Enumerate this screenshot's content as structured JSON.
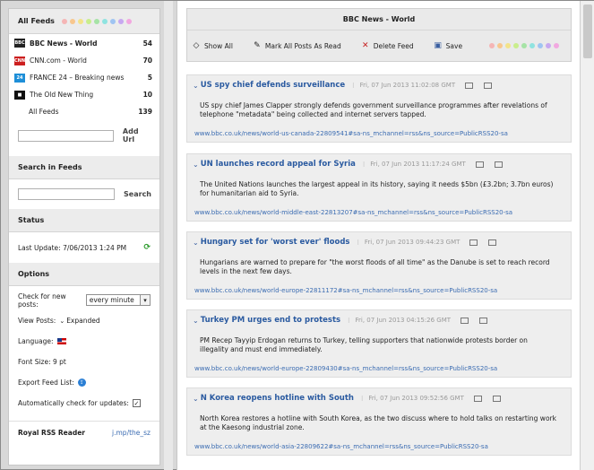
{
  "sidebar": {
    "all_feeds_title": "All Feeds",
    "color_dots": [
      "#f5b5b5",
      "#f8c78e",
      "#f3e38a",
      "#c9ee8c",
      "#a6e3a6",
      "#8fe3e0",
      "#9fc4f2",
      "#c7a8f0",
      "#f2a8e0"
    ],
    "feeds": [
      {
        "name": "BBC News - World",
        "count": "54",
        "fav_color": "#222",
        "fav_text": "BBC"
      },
      {
        "name": "CNN.com - World",
        "count": "70",
        "fav_color": "#cc1f1f",
        "fav_text": "CNN"
      },
      {
        "name": "FRANCE 24 – Breaking news",
        "count": "5",
        "fav_color": "#1e8fd8",
        "fav_text": "24"
      },
      {
        "name": "The Old New Thing",
        "count": "10",
        "fav_color": "#111",
        "fav_text": "■"
      },
      {
        "name": "All Feeds",
        "count": "139"
      }
    ],
    "add_url_label": "Add Url",
    "search_title": "Search in Feeds",
    "search_label": "Search",
    "status_title": "Status",
    "last_update": "Last Update: 7/06/2013 1:24 PM",
    "options_title": "Options",
    "check_label": "Check for new posts:",
    "check_value": "every minute",
    "view_label": "View Posts:",
    "view_value": "Expanded",
    "language_label": "Language:",
    "font_label": "Font Size: 9 pt",
    "export_label": "Export Feed List:",
    "auto_label": "Automatically check for updates:",
    "footer_app": "Royal RSS Reader",
    "footer_link": "j.mp/the_sz"
  },
  "main": {
    "title": "BBC News - World",
    "toolbar": {
      "show_all": "Show All",
      "mark_all": "Mark All Posts As Read",
      "delete_feed": "Delete Feed",
      "save": "Save"
    },
    "posts": [
      {
        "title": "US spy chief defends surveillance",
        "date": "Fri, 07 Jun 2013 11:02:08 GMT",
        "body": "US spy chief James Clapper strongly defends government surveillance programmes after revelations of telephone \"metadata\" being collected and internet servers tapped.",
        "url": "www.bbc.co.uk/news/world-us-canada-22809541#sa-ns_mchannel=rss&ns_source=PublicRSS20-sa"
      },
      {
        "title": "UN launches record appeal for Syria",
        "date": "Fri, 07 Jun 2013 11:17:24 GMT",
        "body": "The United Nations launches the largest appeal in its history, saying it needs $5bn (£3.2bn; 3.7bn euros) for humanitarian aid to Syria.",
        "url": "www.bbc.co.uk/news/world-middle-east-22813207#sa-ns_mchannel=rss&ns_source=PublicRSS20-sa"
      },
      {
        "title": "Hungary set for 'worst ever' floods",
        "date": "Fri, 07 Jun 2013 09:44:23 GMT",
        "body": "Hungarians are warned to prepare for \"the worst floods of all time\" as the Danube is set to reach record levels in the next few days.",
        "url": "www.bbc.co.uk/news/world-europe-22811172#sa-ns_mchannel=rss&ns_source=PublicRSS20-sa"
      },
      {
        "title": "Turkey PM urges end to protests",
        "date": "Fri, 07 Jun 2013 04:15:26 GMT",
        "body": "PM Recep Tayyip Erdogan returns to Turkey, telling supporters that nationwide protests border on illegality and must end immediately.",
        "url": "www.bbc.co.uk/news/world-europe-22809430#sa-ns_mchannel=rss&ns_source=PublicRSS20-sa"
      },
      {
        "title": "N Korea reopens hotline with South",
        "date": "Fri, 07 Jun 2013 09:52:56 GMT",
        "body": "North Korea restores a hotline with South Korea, as the two discuss where to hold talks on restarting work at the Kaesong industrial zone.",
        "url": "www.bbc.co.uk/news/world-asia-22809622#sa-ns_mchannel=rss&ns_source=PublicRSS20-sa"
      }
    ]
  }
}
